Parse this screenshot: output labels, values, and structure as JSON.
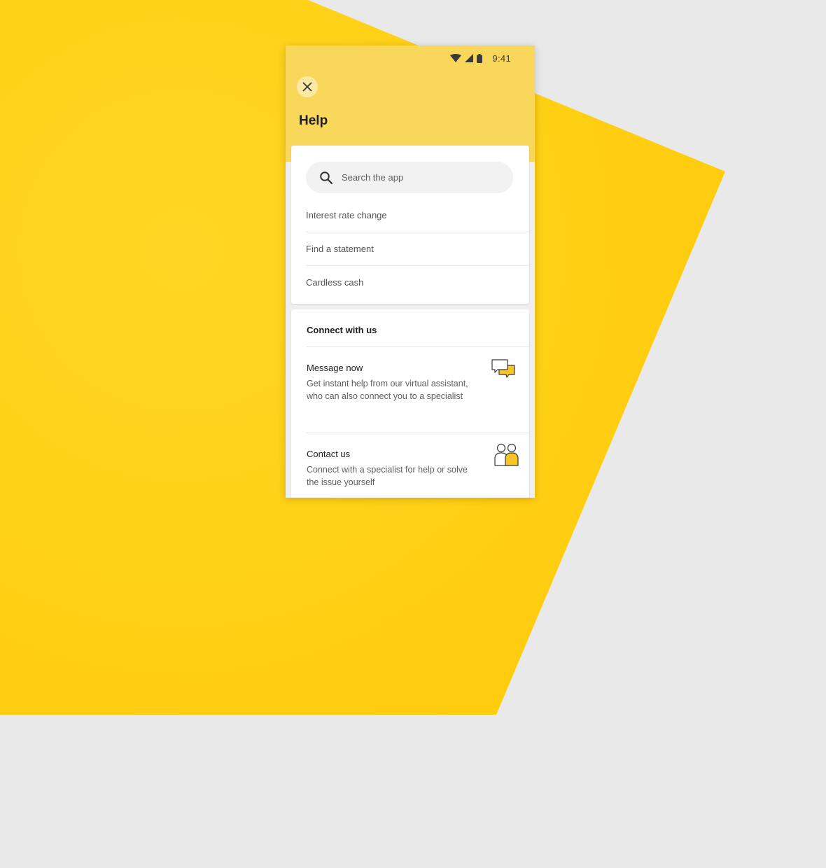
{
  "status_bar": {
    "time": "9:41"
  },
  "header": {
    "title": "Help"
  },
  "search": {
    "placeholder": "Search the app"
  },
  "suggestions": [
    {
      "label": "Interest rate change"
    },
    {
      "label": "Find a statement"
    },
    {
      "label": "Cardless cash"
    }
  ],
  "connect": {
    "title": "Connect with us",
    "options": [
      {
        "title": "Message now",
        "description": "Get instant help from our virtual assistant, who can also connect you to a specialist",
        "icon": "chat-bubbles-icon"
      },
      {
        "title": "Contact us",
        "description": "Connect with a specialist for help or solve the issue yourself",
        "icon": "people-icon"
      }
    ]
  },
  "colors": {
    "brand_yellow": "#ffcc12",
    "header_yellow": "#f9d75a",
    "background": "#e9e9e9"
  }
}
